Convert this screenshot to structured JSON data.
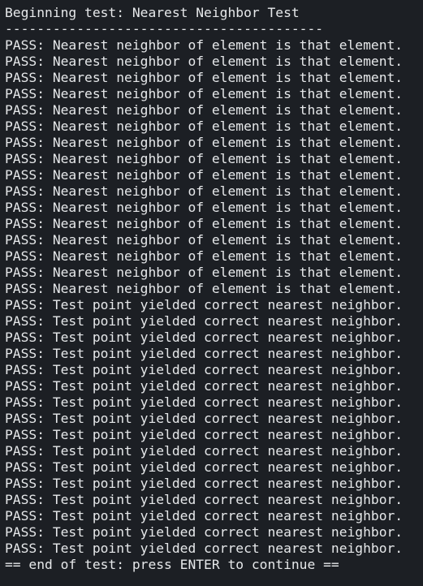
{
  "terminal": {
    "header": "Beginning test: Nearest Neighbor Test",
    "separator": "----------------------------------------",
    "lines": [
      "PASS: Nearest neighbor of element is that element.",
      "PASS: Nearest neighbor of element is that element.",
      "PASS: Nearest neighbor of element is that element.",
      "PASS: Nearest neighbor of element is that element.",
      "PASS: Nearest neighbor of element is that element.",
      "PASS: Nearest neighbor of element is that element.",
      "PASS: Nearest neighbor of element is that element.",
      "PASS: Nearest neighbor of element is that element.",
      "PASS: Nearest neighbor of element is that element.",
      "PASS: Nearest neighbor of element is that element.",
      "PASS: Nearest neighbor of element is that element.",
      "PASS: Nearest neighbor of element is that element.",
      "PASS: Nearest neighbor of element is that element.",
      "PASS: Nearest neighbor of element is that element.",
      "PASS: Nearest neighbor of element is that element.",
      "PASS: Nearest neighbor of element is that element.",
      "PASS: Test point yielded correct nearest neighbor.",
      "PASS: Test point yielded correct nearest neighbor.",
      "PASS: Test point yielded correct nearest neighbor.",
      "PASS: Test point yielded correct nearest neighbor.",
      "PASS: Test point yielded correct nearest neighbor.",
      "PASS: Test point yielded correct nearest neighbor.",
      "PASS: Test point yielded correct nearest neighbor.",
      "PASS: Test point yielded correct nearest neighbor.",
      "PASS: Test point yielded correct nearest neighbor.",
      "PASS: Test point yielded correct nearest neighbor.",
      "PASS: Test point yielded correct nearest neighbor.",
      "PASS: Test point yielded correct nearest neighbor.",
      "PASS: Test point yielded correct nearest neighbor.",
      "PASS: Test point yielded correct nearest neighbor.",
      "PASS: Test point yielded correct nearest neighbor.",
      "PASS: Test point yielded correct nearest neighbor."
    ],
    "footer": "== end of test: press ENTER to continue ==",
    "colors": {
      "background": "#1c1f24",
      "text": "#e6e8ea"
    }
  }
}
